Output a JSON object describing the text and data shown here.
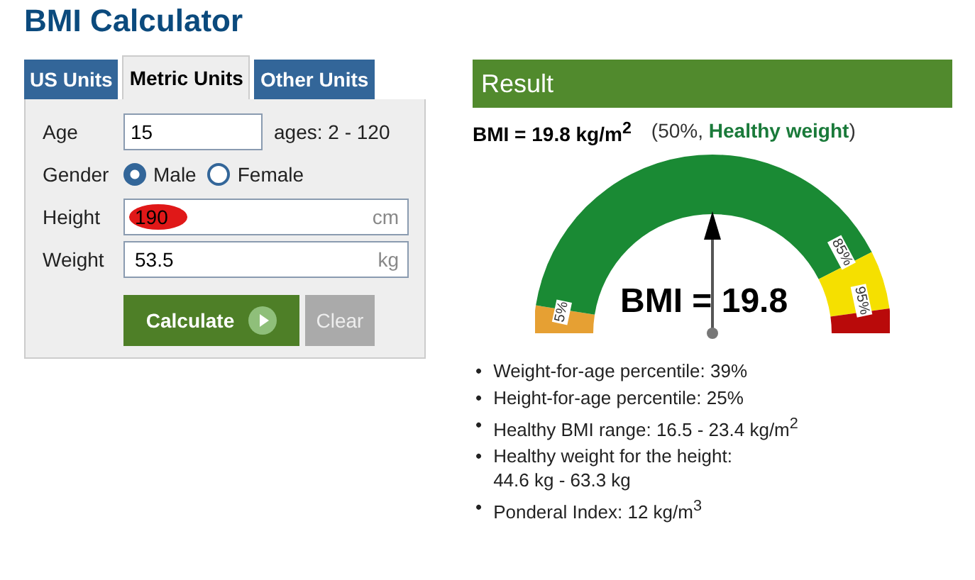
{
  "title": "BMI Calculator",
  "tabs": [
    {
      "label": "US Units",
      "selected": false
    },
    {
      "label": "Metric Units",
      "selected": true
    },
    {
      "label": "Other Units",
      "selected": false
    }
  ],
  "form": {
    "age": {
      "label": "Age",
      "value": "15",
      "hint": "ages: 2 - 120"
    },
    "gender": {
      "label": "Gender",
      "options": [
        {
          "label": "Male",
          "selected": true
        },
        {
          "label": "Female",
          "selected": false
        }
      ]
    },
    "height": {
      "label": "Height",
      "value": "190",
      "unit": "cm",
      "scribbled": true
    },
    "weight": {
      "label": "Weight",
      "value": "53.5",
      "unit": "kg",
      "scribbled": false
    },
    "buttons": [
      {
        "label": "Calculate",
        "kind": "primary"
      },
      {
        "label": "Clear",
        "kind": "secondary"
      }
    ]
  },
  "result": {
    "header": "Result",
    "summary": "BMI = 19.8 kg/m$^{2}$",
    "percent": "(50%, ",
    "category": "Healthy weight",
    "close": ")",
    "gauge": {
      "value_label": "BMI = 19.8",
      "marks": [
        "5%",
        "85%",
        "95%"
      ]
    },
    "details": [
      {
        "bullet": "•",
        "text": "Weight-for-age percentile: 39%"
      },
      {
        "bullet": "•",
        "text": "Height-for-age percentile: 25%"
      },
      {
        "bullet": "•",
        "text": "Healthy BMI range: 16.5 - 23.4 kg/m$^{2}$"
      },
      {
        "bullet": "•",
        "text": "Healthy weight for the height:\n44.6 kg - 63.3 kg"
      },
      {
        "bullet": "•",
        "text": "Ponderal Index: 12 kg/m$^{3}$"
      }
    ]
  }
}
